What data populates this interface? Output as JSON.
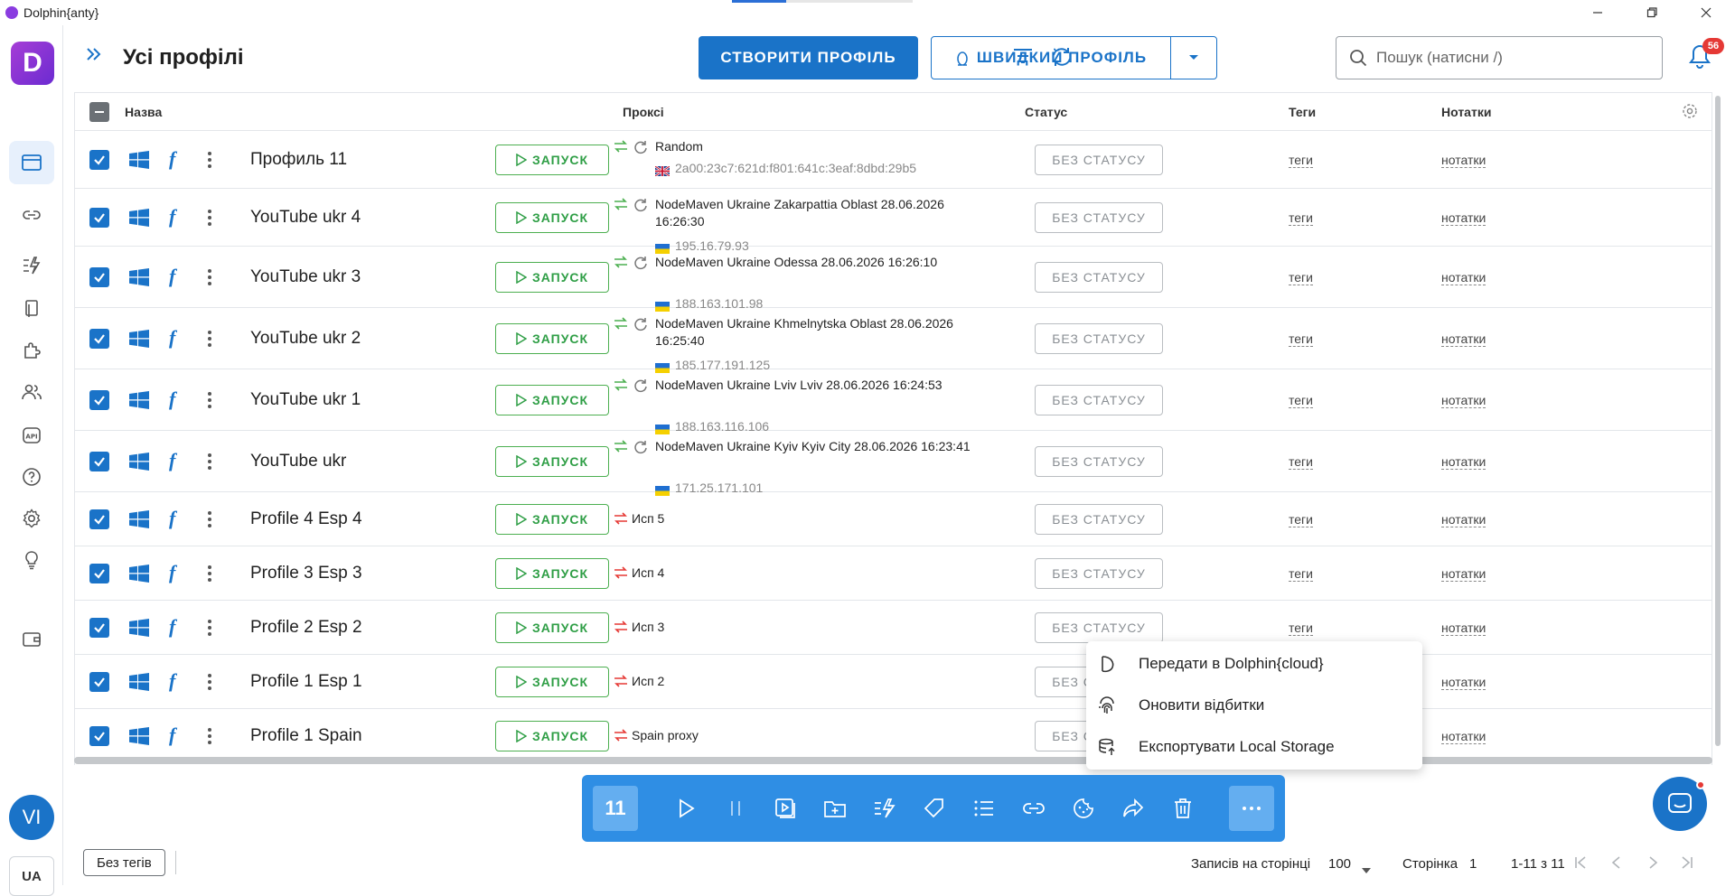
{
  "app": {
    "title": "Dolphin{anty}"
  },
  "header": {
    "title": "Усі профілі",
    "create_label": "СТВОРИТИ ПРОФІЛЬ",
    "quick_label": "ШВИДКИЙ ПРОФІЛЬ",
    "search_placeholder": "Пошук (натисни /)",
    "notifications_count": "56"
  },
  "sidebar": {
    "brand": "D",
    "avatar": "VI",
    "language": "UA"
  },
  "table": {
    "columns": {
      "name": "Назва",
      "proxy": "Проксі",
      "status": "Статус",
      "tags": "Теги",
      "notes": "Нотатки"
    },
    "launch_label": "ЗАПУСК",
    "status_label": "БЕЗ СТАТУСУ",
    "tag_label": "теги",
    "note_label": "нотатки",
    "rows": [
      {
        "name": "Профиль 11",
        "proxy": "Random",
        "ip": "2a00:23c7:621d:f801:641c:3eaf:8dbd:29b5",
        "flag": "uk"
      },
      {
        "name": "YouTube ukr 4",
        "proxy": "NodeMaven Ukraine Zakarpattia Oblast 28.06.2026 16:26:30",
        "ip": "195.16.79.93",
        "flag": "ua"
      },
      {
        "name": "YouTube ukr 3",
        "proxy": "NodeMaven Ukraine Odessa 28.06.2026 16:26:10",
        "ip": "188.163.101.98",
        "flag": "ua"
      },
      {
        "name": "YouTube ukr 2",
        "proxy": "NodeMaven Ukraine Khmelnytska Oblast 28.06.2026 16:25:40",
        "ip": "185.177.191.125",
        "flag": "ua"
      },
      {
        "name": "YouTube ukr 1",
        "proxy": "NodeMaven Ukraine Lviv Lviv 28.06.2026 16:24:53",
        "ip": "188.163.116.106",
        "flag": "ua"
      },
      {
        "name": "YouTube ukr",
        "proxy": "NodeMaven Ukraine Kyiv Kyiv City 28.06.2026 16:23:41",
        "ip": "171.25.171.101",
        "flag": "ua"
      },
      {
        "name": "Profile 4 Esp 4",
        "proxy": "Исп 5",
        "ip": "",
        "flag": ""
      },
      {
        "name": "Profile 3 Esp 3",
        "proxy": "Исп 4",
        "ip": "",
        "flag": ""
      },
      {
        "name": "Profile 2 Esp 2",
        "proxy": "Исп 3",
        "ip": "",
        "flag": ""
      },
      {
        "name": "Profile 1 Esp 1",
        "proxy": "Исп 2",
        "ip": "",
        "flag": ""
      },
      {
        "name": "Profile 1 Spain",
        "proxy": "Spain proxy",
        "ip": "",
        "flag": ""
      }
    ]
  },
  "context_menu": {
    "items": [
      {
        "label": "Передати в Dolphin{cloud}",
        "icon": "dolphin-cloud-icon"
      },
      {
        "label": "Оновити відбитки",
        "icon": "fingerprint-icon"
      },
      {
        "label": "Експортувати Local Storage",
        "icon": "export-storage-icon"
      }
    ]
  },
  "action_bar": {
    "selected_count": "11"
  },
  "footer": {
    "no_tags": "Без тегів",
    "per_page_label": "Записів на сторінці",
    "per_page_value": "100",
    "page_label": "Сторінка",
    "page_value": "1",
    "range": "1-11 з 11"
  },
  "colors": {
    "accent": "#1a73c8",
    "launch": "#4caf50",
    "badge": "#e53935"
  }
}
